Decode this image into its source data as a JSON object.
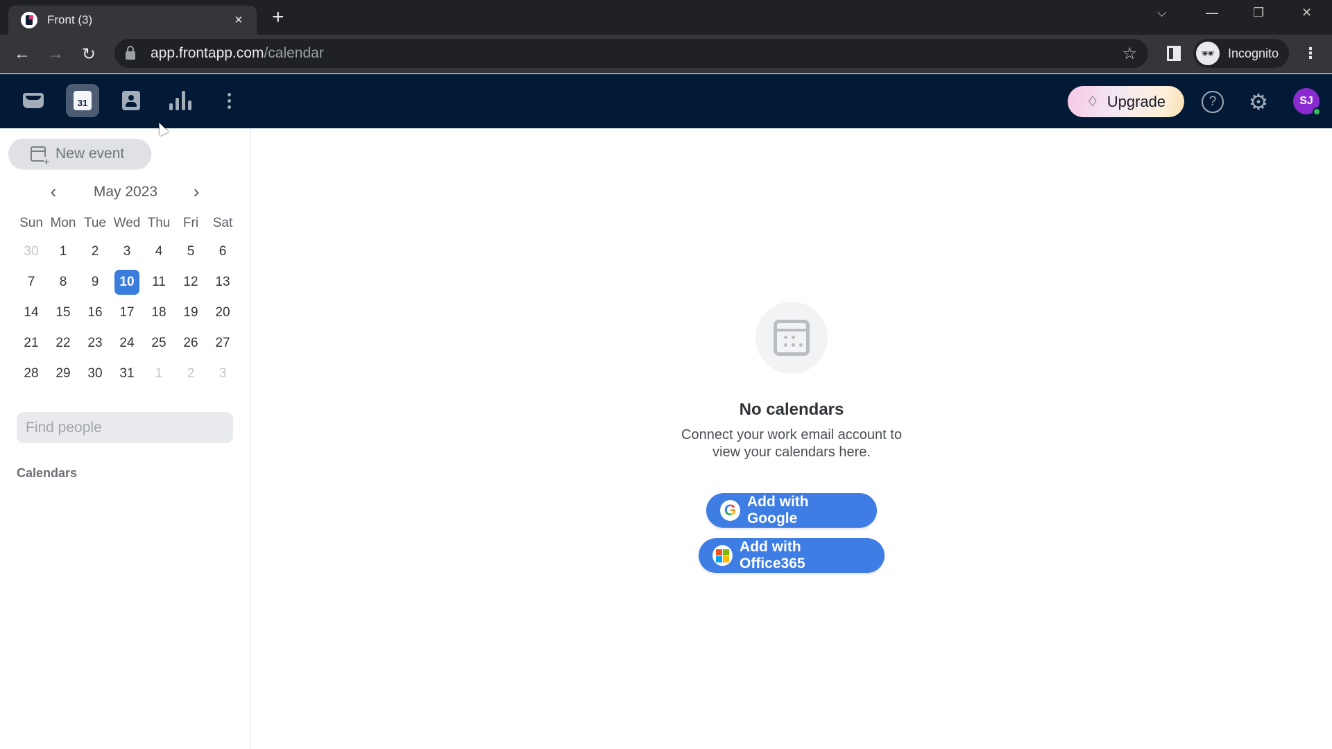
{
  "browser": {
    "tab_title": "Front (3)",
    "tab_close_icon": "×",
    "new_tab_icon": "+",
    "url_host": "app.frontapp.com",
    "url_path": "/calendar",
    "profile_label": "Incognito",
    "window_controls": {
      "tab_search": "⌵",
      "minimize": "—",
      "restore": "❐",
      "close": "✕"
    },
    "nav": {
      "back": "←",
      "forward": "→",
      "reload": "↻",
      "bookmark": "☆",
      "menu": "⋮"
    }
  },
  "appbar": {
    "calendar_icon_day": "31",
    "upgrade_label": "Upgrade",
    "upgrade_icon": "♢",
    "help_icon": "?",
    "settings_icon": "⚙",
    "avatar_initials": "SJ",
    "colors": {
      "header_bg": "#021a36",
      "avatar_bg": "#8a2bd1",
      "online": "#2fbf5c"
    }
  },
  "sidebar": {
    "new_event_label": "New event",
    "calendar": {
      "title": "May 2023",
      "prev_icon": "‹",
      "next_icon": "›",
      "weekdays": [
        "Sun",
        "Mon",
        "Tue",
        "Wed",
        "Thu",
        "Fri",
        "Sat"
      ],
      "weeks": [
        [
          {
            "d": "30",
            "muted": true
          },
          {
            "d": "1"
          },
          {
            "d": "2"
          },
          {
            "d": "3"
          },
          {
            "d": "4"
          },
          {
            "d": "5"
          },
          {
            "d": "6"
          }
        ],
        [
          {
            "d": "7"
          },
          {
            "d": "8"
          },
          {
            "d": "9"
          },
          {
            "d": "10",
            "today": true
          },
          {
            "d": "11"
          },
          {
            "d": "12"
          },
          {
            "d": "13"
          }
        ],
        [
          {
            "d": "14"
          },
          {
            "d": "15"
          },
          {
            "d": "16"
          },
          {
            "d": "17"
          },
          {
            "d": "18"
          },
          {
            "d": "19"
          },
          {
            "d": "20"
          }
        ],
        [
          {
            "d": "21"
          },
          {
            "d": "22"
          },
          {
            "d": "23"
          },
          {
            "d": "24"
          },
          {
            "d": "25"
          },
          {
            "d": "26"
          },
          {
            "d": "27"
          }
        ],
        [
          {
            "d": "28"
          },
          {
            "d": "29"
          },
          {
            "d": "30"
          },
          {
            "d": "31"
          },
          {
            "d": "1",
            "muted": true
          },
          {
            "d": "2",
            "muted": true
          },
          {
            "d": "3",
            "muted": true
          }
        ]
      ],
      "today_color": "#3b7ddd"
    },
    "find_people_placeholder": "Find people",
    "find_people_value": "",
    "calendars_label": "Calendars"
  },
  "main": {
    "empty_title": "No calendars",
    "empty_desc": "Connect your work email account to view your calendars here.",
    "google_button": "Add with Google",
    "office_button": "Add with Office365",
    "google_logo": "G",
    "button_color": "#3e7de3"
  }
}
